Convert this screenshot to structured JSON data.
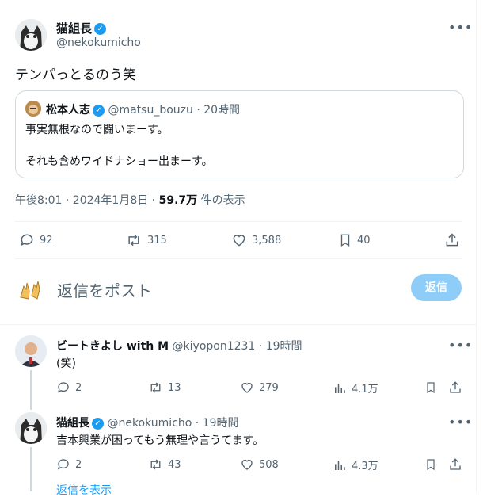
{
  "main_tweet": {
    "display_name": "猫組長",
    "handle": "@nekokumicho",
    "text": "テンパっとるのう笑",
    "timestamp": "午後8:01 · 2024年1月8日 · ",
    "views_count": "59.7万",
    "views_label": " 件の表示",
    "quote": {
      "display_name": "松本人志",
      "handle": "@matsu_bouzu",
      "time": "· 20時間",
      "line1": "事実無根なので闘いまーす。",
      "line2": "それも含めワイドナショー出まーす。"
    },
    "actions": {
      "replies": "92",
      "reposts": "315",
      "likes": "3,588",
      "bookmarks": "40"
    }
  },
  "composer": {
    "placeholder": "返信をポスト",
    "button_label": "返信"
  },
  "replies": [
    {
      "display_name": "ビートきよし with M",
      "handle": "@kiyopon1231",
      "time": "· 19時間",
      "text": "(笑)",
      "replies": "2",
      "reposts": "13",
      "likes": "279",
      "views": "4.1万"
    },
    {
      "display_name": "猫組長",
      "handle": "@nekokumicho",
      "time": "· 19時間",
      "text": "吉本興業が困ってもう無理や言うてます。",
      "replies": "2",
      "reposts": "43",
      "likes": "508",
      "views": "4.3万"
    }
  ],
  "show_replies": "返信を表示",
  "colors": {
    "accent": "#1d9bf0",
    "muted": "#536471",
    "border": "#cfd9de"
  }
}
